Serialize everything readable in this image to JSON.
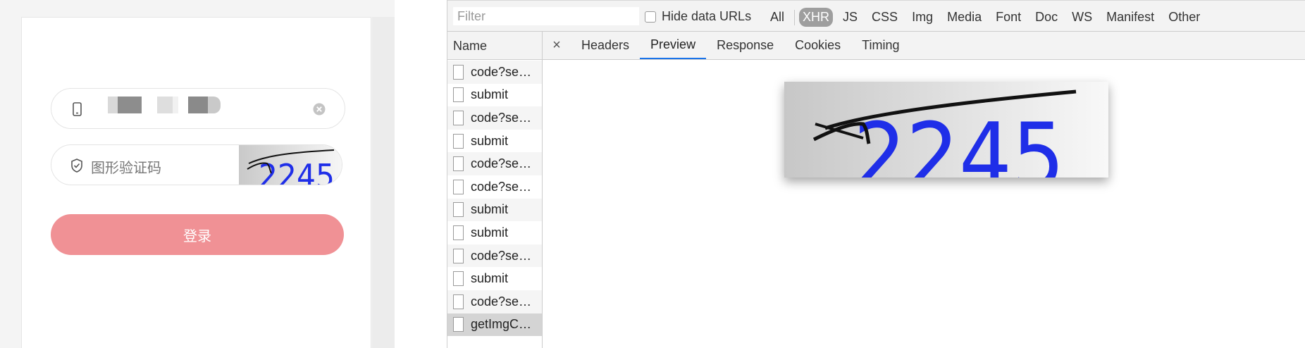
{
  "login": {
    "phone_masked": "",
    "captcha_placeholder": "图形验证码",
    "captcha_image_text": "2245",
    "login_button": "登录",
    "button_color": "#f09195"
  },
  "devtools": {
    "filter_placeholder": "Filter",
    "hide_data_urls_label": "Hide data URLs",
    "type_filters": [
      "All",
      "XHR",
      "JS",
      "CSS",
      "Img",
      "Media",
      "Font",
      "Doc",
      "WS",
      "Manifest",
      "Other"
    ],
    "active_type_filter": "XHR",
    "name_header": "Name",
    "requests": [
      "code?se…",
      "submit",
      "code?se…",
      "submit",
      "code?se…",
      "code?se…",
      "submit",
      "submit",
      "code?se…",
      "submit",
      "code?se…",
      "getImgC…"
    ],
    "selected_request": "getImgC…",
    "close_icon": "×",
    "detail_tabs": [
      "Headers",
      "Preview",
      "Response",
      "Cookies",
      "Timing"
    ],
    "active_detail_tab": "Preview",
    "preview_image_text": "2245",
    "accent_color": "#1a73e8"
  }
}
